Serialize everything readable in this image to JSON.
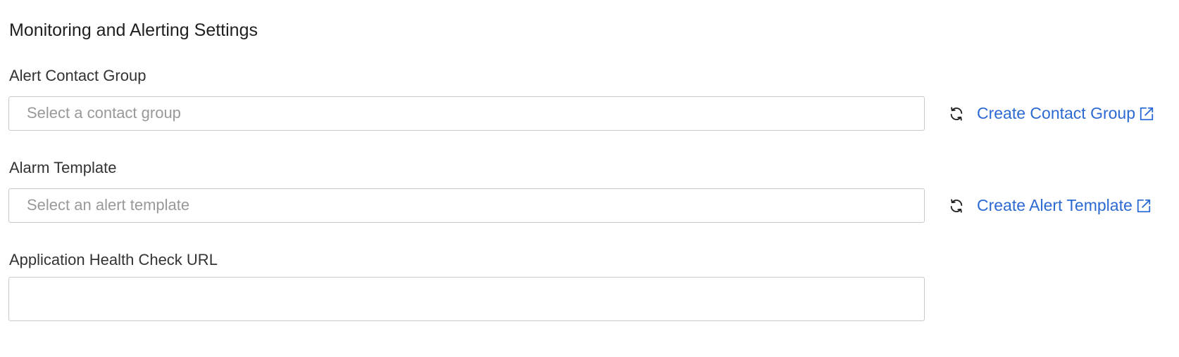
{
  "section": {
    "title": "Monitoring and Alerting Settings"
  },
  "fields": {
    "contact_group": {
      "label": "Alert Contact Group",
      "placeholder": "Select a contact group",
      "refresh_icon": "refresh-icon",
      "create_link": "Create Contact Group",
      "create_link_icon": "external-link-icon"
    },
    "alarm_template": {
      "label": "Alarm Template",
      "placeholder": "Select an alert template",
      "refresh_icon": "refresh-icon",
      "create_link": "Create Alert Template",
      "create_link_icon": "external-link-icon"
    },
    "health_check": {
      "label": "Application Health Check URL",
      "value": ""
    }
  },
  "colors": {
    "link": "#2b6ad3",
    "border": "#c9c9c9",
    "placeholder": "#999999",
    "label": "#333333"
  }
}
